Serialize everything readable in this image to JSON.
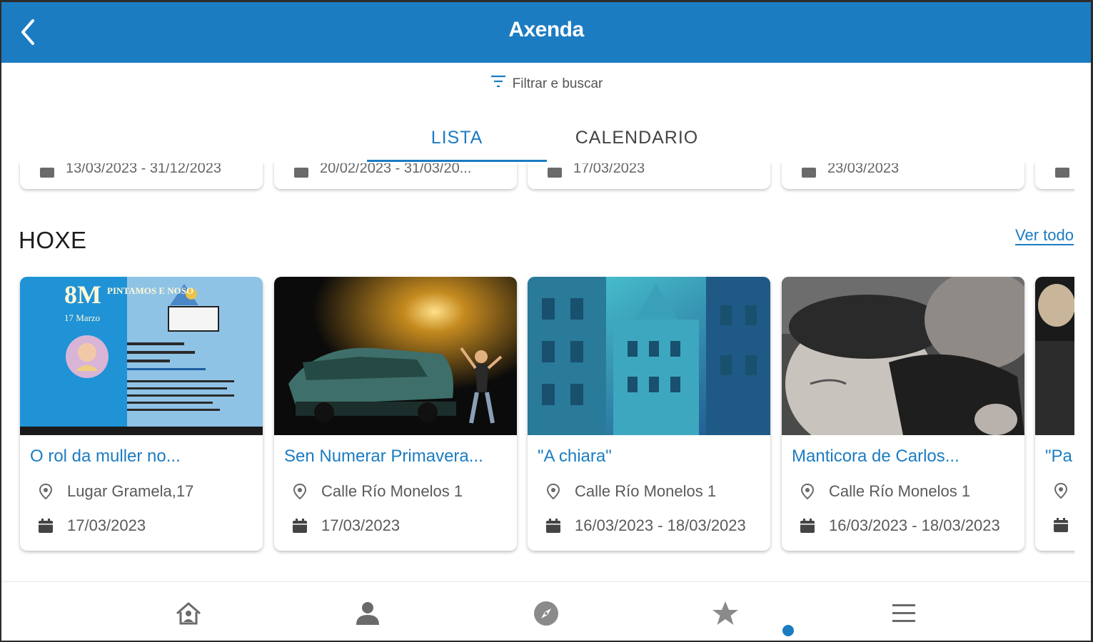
{
  "app_bar": {
    "title": "Axenda"
  },
  "filter": {
    "label": "Filtrar e buscar"
  },
  "tabs": [
    {
      "label": "LISTA",
      "active": true
    },
    {
      "label": "CALENDARIO",
      "active": false
    }
  ],
  "previous_row": {
    "dates": [
      "13/03/2023 - 31/12/2023",
      "20/02/2023 - 31/03/20...",
      "17/03/2023",
      "23/03/2023"
    ]
  },
  "section": {
    "title": "HOXE",
    "see_all": "Ver todo"
  },
  "events": [
    {
      "title": "O rol da muller no...",
      "location": "Lugar Gramela,17",
      "date": "17/03/2023"
    },
    {
      "title": "Sen Numerar Primavera...",
      "location": "Calle Río Monelos 1",
      "date": "17/03/2023"
    },
    {
      "title": "\"A chiara\"",
      "location": "Calle Río Monelos 1",
      "date": "16/03/2023 - 18/03/2023"
    },
    {
      "title": "Manticora de Carlos...",
      "location": "Calle Río Monelos 1",
      "date": "16/03/2023 - 18/03/2023"
    },
    {
      "title": "\"Pa",
      "location": "",
      "date": ""
    }
  ],
  "poster": {
    "big": "8M",
    "small": "PINTAMOS E NOSO",
    "date_line": "17 Marzo",
    "subtitle": "O ROL DA MULLER NO ASOCIACIONISMO DEPORTIVO"
  },
  "bottom_nav": [
    {
      "icon": "home-icon"
    },
    {
      "icon": "person-icon"
    },
    {
      "icon": "compass-icon"
    },
    {
      "icon": "star-icon"
    },
    {
      "icon": "menu-icon"
    }
  ],
  "colors": {
    "primary": "#1c7cc1",
    "text": "#1d1d1d",
    "muted": "#5a5a5a"
  }
}
